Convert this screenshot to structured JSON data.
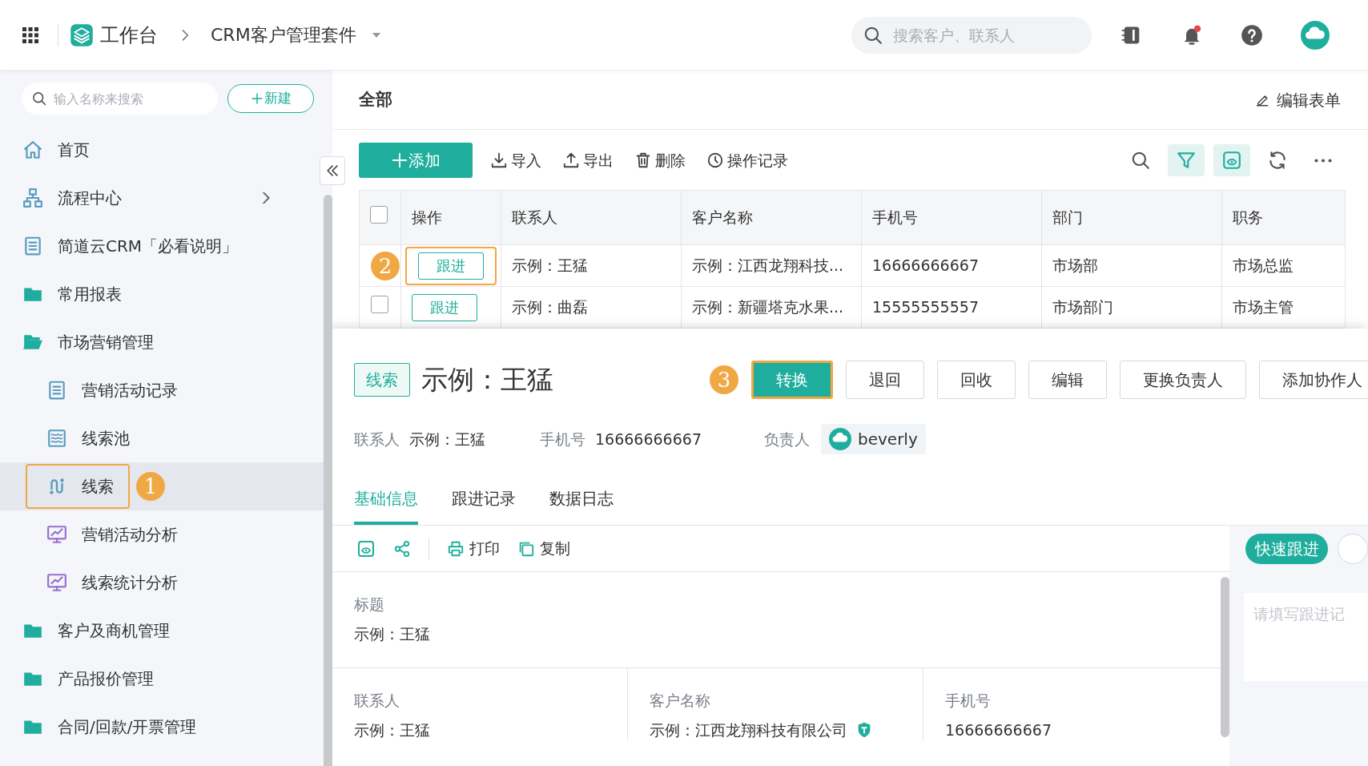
{
  "topbar": {
    "app": "工作台",
    "suite": "CRM客户管理套件",
    "search": {
      "placeholder": "搜索客户、联系人"
    }
  },
  "sidebar": {
    "search": {
      "placeholder": "输入名称来搜索"
    },
    "new_button": "新建",
    "items": [
      {
        "kind": "home",
        "label": "首页",
        "selected": false
      },
      {
        "kind": "flow",
        "label": "流程中心",
        "selected": false
      },
      {
        "kind": "doc",
        "label": "简道云CRM「必看说明」",
        "selected": false
      },
      {
        "kind": "folder",
        "label": "常用报表",
        "selected": false,
        "expanded": false
      },
      {
        "kind": "folder",
        "label": "市场营销管理",
        "selected": false,
        "expanded": true,
        "children": [
          {
            "kind": "doc",
            "label": "营销活动记录",
            "selected": false
          },
          {
            "kind": "pool",
            "label": "线索池",
            "selected": false
          },
          {
            "kind": "lead",
            "label": "线索",
            "selected": true,
            "callout": "1"
          },
          {
            "kind": "chart",
            "label": "营销活动分析",
            "selected": false
          },
          {
            "kind": "chart",
            "label": "线索统计分析",
            "selected": false
          }
        ]
      },
      {
        "kind": "folder",
        "label": "客户及商机管理",
        "selected": false,
        "expanded": false
      },
      {
        "kind": "folder",
        "label": "产品报价管理",
        "selected": false,
        "expanded": false
      },
      {
        "kind": "folder",
        "label": "合同/回款/开票管理",
        "selected": false,
        "expanded": false
      }
    ]
  },
  "main": {
    "title": "全部",
    "edit_form": "编辑表单",
    "add_button": "添加",
    "actions": [
      {
        "kind": "import",
        "label": "导入"
      },
      {
        "kind": "export",
        "label": "导出"
      },
      {
        "kind": "delete",
        "label": "删除"
      },
      {
        "kind": "history",
        "label": "操作记录"
      }
    ],
    "tools": [
      {
        "kind": "search",
        "active": false
      },
      {
        "kind": "filter",
        "active": true
      },
      {
        "kind": "view",
        "active": true
      },
      {
        "kind": "refresh",
        "active": false
      },
      {
        "kind": "more",
        "active": false
      }
    ],
    "table": {
      "columns": [
        "操作",
        "联系人",
        "客户名称",
        "手机号",
        "部门",
        "职务"
      ],
      "header_checked": false,
      "rows": [
        {
          "callout": "2",
          "cells": [
            "跟进",
            "示例：王猛",
            "示例：江西龙翔科技...",
            "16666666667",
            "市场部",
            "市场总监"
          ]
        },
        {
          "checked": false,
          "cells": [
            "跟进",
            "示例：曲磊",
            "示例：新疆塔克水果...",
            "15555555557",
            "市场部门",
            "市场主管"
          ]
        }
      ]
    }
  },
  "detail": {
    "tag": "线索",
    "title": "示例：王猛",
    "buttons": [
      {
        "label": "转换",
        "primary": true,
        "callout": "3"
      },
      {
        "label": "退回",
        "primary": false
      },
      {
        "label": "回收",
        "primary": false
      },
      {
        "label": "编辑",
        "primary": false
      },
      {
        "label": "更换负责人",
        "primary": false
      },
      {
        "label": "添加协作人",
        "primary": false
      }
    ],
    "info": [
      {
        "label": "联系人",
        "value": "示例：王猛"
      },
      {
        "label": "手机号",
        "value": "16666666667"
      }
    ],
    "owner": {
      "label": "负责人",
      "name": "beverly"
    },
    "tabs": [
      {
        "label": "基础信息",
        "selected": true
      },
      {
        "label": "跟进记录",
        "selected": false
      },
      {
        "label": "数据日志",
        "selected": false
      }
    ],
    "tools": [
      {
        "kind": "print",
        "label": "打印"
      },
      {
        "kind": "copy",
        "label": "复制"
      }
    ],
    "fields": [
      {
        "label": "标题",
        "value": "示例：王猛"
      }
    ],
    "field_grid": [
      {
        "label": "联系人",
        "value": "示例：王猛",
        "verified": false
      },
      {
        "label": "客户名称",
        "value": "示例：江西龙翔科技有限公司",
        "verified": true
      },
      {
        "label": "手机号",
        "value": "16666666667",
        "verified": false
      }
    ],
    "side": {
      "quick_button": "快速跟进",
      "placeholder": "请填写跟进记"
    }
  }
}
